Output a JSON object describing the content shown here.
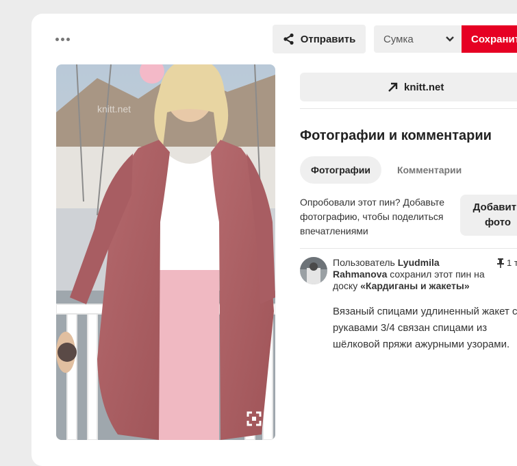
{
  "header": {
    "more_icon": "ellipsis-icon",
    "send_label": "Отправить",
    "board_selected": "Сумка",
    "save_label": "Сохранить"
  },
  "image": {
    "watermark": "knitt.net"
  },
  "source": {
    "label": "knitt.net",
    "icon": "arrow-up-right-icon"
  },
  "section": {
    "title": "Фотографии и комментарии",
    "tabs": [
      {
        "label": "Фотографии",
        "active": true
      },
      {
        "label": "Комментарии",
        "active": false
      }
    ],
    "prompt": "Опробовали этот пин? Добавьте фотографию, чтобы поделиться впечатлениями",
    "add_photo_line1": "Добавить",
    "add_photo_line2": "фото"
  },
  "activity": {
    "prefix": "Пользователь ",
    "user": "Lyudmila Rahmanova",
    "middle": " сохранил этот пин на доску ",
    "board": "«Кардиганы и жакеты»",
    "pin_count": "1 т",
    "description": "Вязаный спицами удлиненный жакет с\nрукавами 3/4 связан спицами из\nшёлковой пряжи ажурными узорами."
  },
  "colors": {
    "accent": "#e60023",
    "button_bg": "#efefef"
  }
}
